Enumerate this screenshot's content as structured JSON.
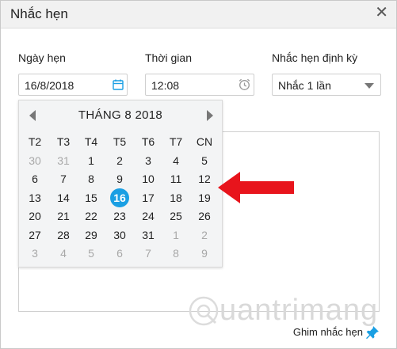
{
  "dialog": {
    "title": "Nhắc hẹn",
    "close_glyph": "✕"
  },
  "fields": {
    "date_label": "Ngày hẹn",
    "date_value": "16/8/2018",
    "time_label": "Thời gian",
    "time_value": "12:08",
    "repeat_label": "Nhắc hẹn định kỳ",
    "repeat_value": "Nhắc 1 lần"
  },
  "calendar": {
    "header": "THÁNG 8 2018",
    "weekdays": [
      "T2",
      "T3",
      "T4",
      "T5",
      "T6",
      "T7",
      "CN"
    ],
    "weeks": [
      [
        {
          "d": "30",
          "out": true
        },
        {
          "d": "31",
          "out": true
        },
        {
          "d": "1"
        },
        {
          "d": "2"
        },
        {
          "d": "3"
        },
        {
          "d": "4"
        },
        {
          "d": "5"
        }
      ],
      [
        {
          "d": "6"
        },
        {
          "d": "7"
        },
        {
          "d": "8"
        },
        {
          "d": "9"
        },
        {
          "d": "10"
        },
        {
          "d": "11"
        },
        {
          "d": "12"
        }
      ],
      [
        {
          "d": "13"
        },
        {
          "d": "14"
        },
        {
          "d": "15"
        },
        {
          "d": "16",
          "selected": true
        },
        {
          "d": "17"
        },
        {
          "d": "18"
        },
        {
          "d": "19"
        }
      ],
      [
        {
          "d": "20"
        },
        {
          "d": "21"
        },
        {
          "d": "22"
        },
        {
          "d": "23"
        },
        {
          "d": "24"
        },
        {
          "d": "25"
        },
        {
          "d": "26"
        }
      ],
      [
        {
          "d": "27"
        },
        {
          "d": "28"
        },
        {
          "d": "29"
        },
        {
          "d": "30"
        },
        {
          "d": "31"
        },
        {
          "d": "1",
          "out": true
        },
        {
          "d": "2",
          "out": true
        }
      ],
      [
        {
          "d": "3",
          "out": true
        },
        {
          "d": "4",
          "out": true
        },
        {
          "d": "5",
          "out": true
        },
        {
          "d": "6",
          "out": true
        },
        {
          "d": "7",
          "out": true
        },
        {
          "d": "8",
          "out": true
        },
        {
          "d": "9",
          "out": true
        }
      ]
    ]
  },
  "footer": {
    "pin_label": "Ghim nhắc hẹn"
  },
  "watermark": {
    "text": "uantrimang"
  },
  "icons": {
    "date": "calendar-icon",
    "time": "alarm-clock-icon",
    "repeat": "chevron-down-icon",
    "pin": "pin-icon",
    "highlight": "red-arrow-icon"
  },
  "colors": {
    "accent": "#1a9fe3",
    "arrow": "#e8141c",
    "watermark": "#d9d9d9"
  }
}
